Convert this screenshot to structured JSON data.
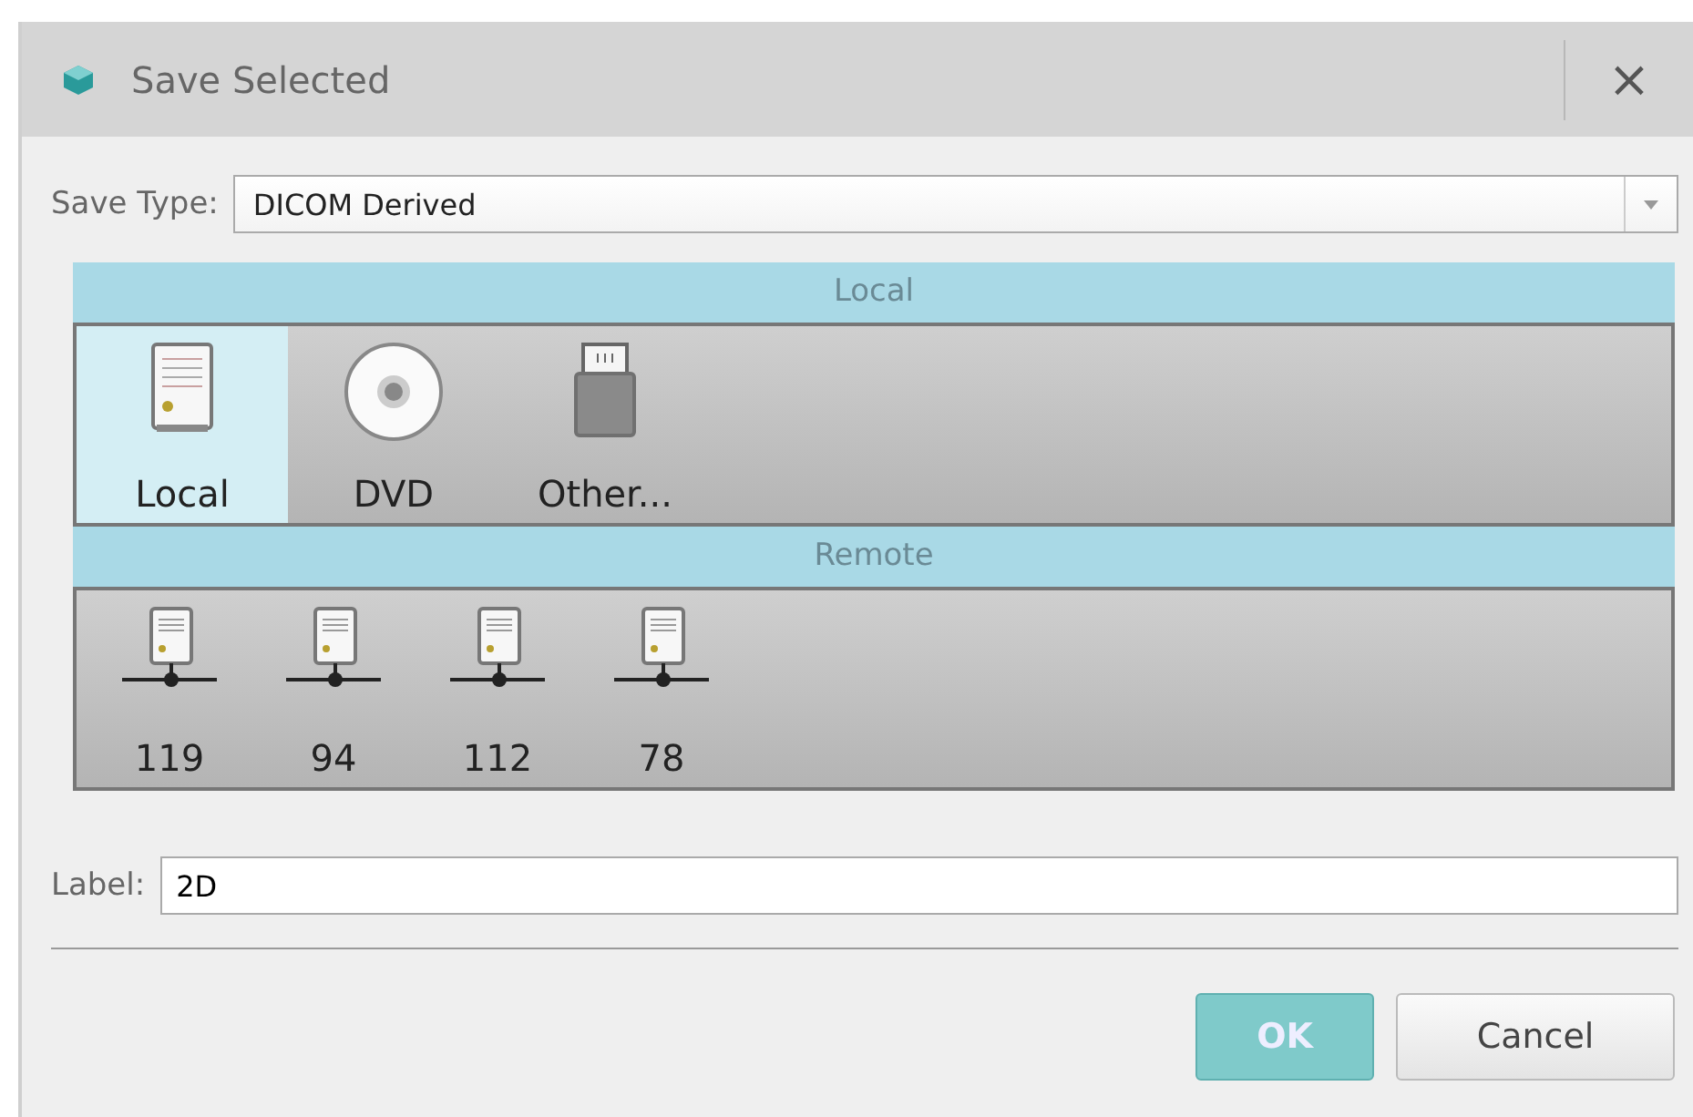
{
  "window": {
    "title": "Save Selected",
    "close": "×"
  },
  "save_type": {
    "label": "Save Type:",
    "value": "DICOM Derived"
  },
  "sections": [
    {
      "title": "Local",
      "items": [
        {
          "label": "Local",
          "kind": "drive",
          "selected": true
        },
        {
          "label": "DVD",
          "kind": "disc",
          "selected": false
        },
        {
          "label": "Other...",
          "kind": "usb",
          "selected": false
        }
      ]
    },
    {
      "title": "Remote",
      "items": [
        {
          "label": "119",
          "kind": "server",
          "selected": false
        },
        {
          "label": "94",
          "kind": "server",
          "selected": false
        },
        {
          "label": "112",
          "kind": "server",
          "selected": false
        },
        {
          "label": "78",
          "kind": "server",
          "selected": false
        }
      ]
    }
  ],
  "label_field": {
    "label": "Label:",
    "value": "2D"
  },
  "buttons": [
    {
      "label": "OK",
      "kind": "primary"
    },
    {
      "label": "Cancel",
      "kind": "secondary"
    }
  ]
}
